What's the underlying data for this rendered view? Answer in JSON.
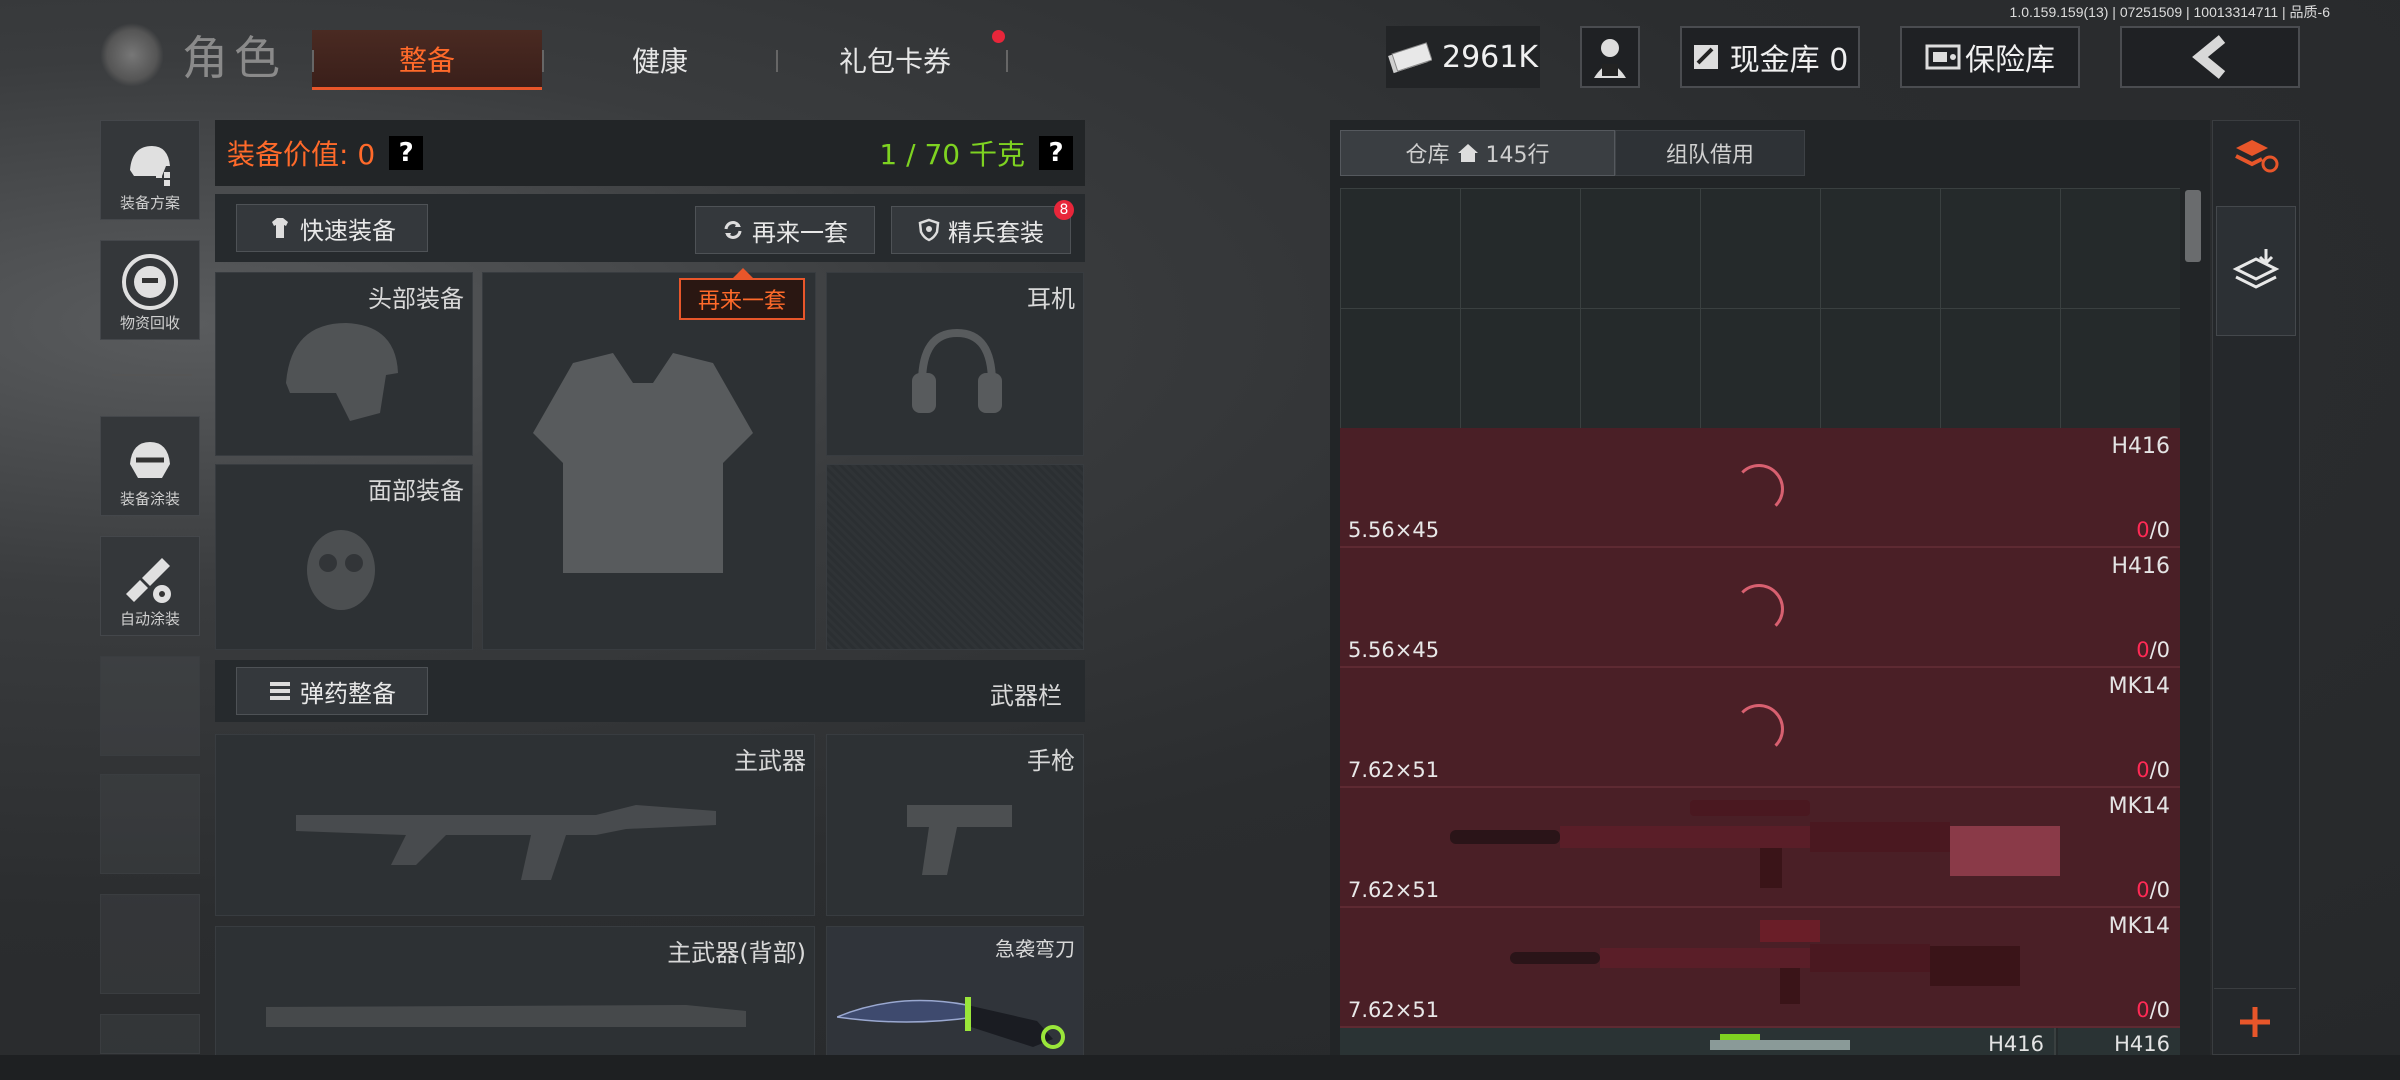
{
  "version": "1.0.159.159(13) | 07251509 | 10013314711 | 品质-6",
  "header": {
    "title": "角色",
    "tabs": [
      "整备",
      "健康",
      "礼包卡券"
    ],
    "currency": "2961K",
    "cash_vault": "现金库 0",
    "safe_vault": "保险库"
  },
  "sidebar": [
    {
      "label": "装备方案",
      "icon": "helmet-gear-icon"
    },
    {
      "label": "物资回收",
      "icon": "recycle-face-icon"
    },
    {
      "label": "装备涂装",
      "icon": "helmet-paint-icon"
    },
    {
      "label": "自动涂装",
      "icon": "brush-gear-icon"
    }
  ],
  "equip": {
    "value_label": "装备价值: 0",
    "weight": "1 / 70 千克",
    "qmark": "?",
    "quick_equip": "快速装备",
    "again": "再来一套",
    "elite": "精兵套装",
    "elite_badge": "8",
    "tooltip": "再来一套",
    "slots": {
      "head": "头部装备",
      "face": "面部装备",
      "ear": "耳机",
      "primary": "主武器",
      "pistol": "手枪",
      "primary_back": "主武器(背部)",
      "knife": "急袭弯刀"
    },
    "ammo": "弹药整备",
    "weapon_bar": "武器栏"
  },
  "warehouse": {
    "tab1": "仓库",
    "rows": "145行",
    "tab2": "组队借用",
    "items": [
      {
        "name": "H416",
        "cal": "5.56×45",
        "a": "0",
        "b": "/0"
      },
      {
        "name": "H416",
        "cal": "5.56×45",
        "a": "0",
        "b": "/0"
      },
      {
        "name": "MK14",
        "cal": "7.62×51",
        "a": "0",
        "b": "/0"
      },
      {
        "name": "MK14",
        "cal": "7.62×51",
        "a": "0",
        "b": "/0"
      },
      {
        "name": "MK14",
        "cal": "7.62×51",
        "a": "0",
        "b": "/0"
      }
    ],
    "partial": [
      "H416",
      "H416"
    ]
  },
  "colors": {
    "accent": "#e8562a",
    "green": "#7ed321",
    "red": "#ff2a55"
  }
}
